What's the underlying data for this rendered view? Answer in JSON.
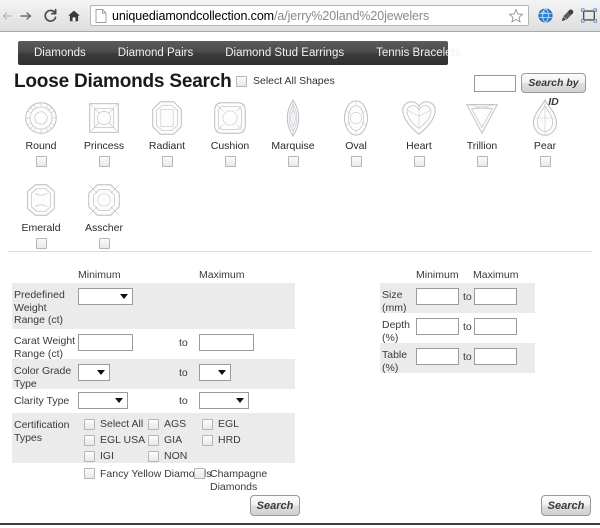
{
  "browser": {
    "back_icon": "back-arrow-icon",
    "forward_icon": "forward-arrow-icon",
    "reload_icon": "reload-icon",
    "home_icon": "home-icon",
    "page_icon": "page-document-icon",
    "url_domain": "uniquediamondcollection.com",
    "url_path": "/a/jerry%20land%20jewelers",
    "star_icon": "bookmark-star-icon",
    "globe_icon": "globe-icon",
    "eyedropper_icon": "eyedropper-icon",
    "capture_icon": "screen-capture-icon"
  },
  "site_nav": {
    "items": [
      {
        "label": "Diamonds"
      },
      {
        "label": "Diamond Pairs"
      },
      {
        "label": "Diamond Stud Earrings"
      },
      {
        "label": "Tennis Bracelets"
      }
    ]
  },
  "header": {
    "title": "Loose Diamonds Search",
    "select_all_shapes_label": "Select All Shapes",
    "search_by_id_value": "",
    "search_by_id_label": "Search by ID"
  },
  "shapes": [
    {
      "label": "Round",
      "icon": "diamond-round-icon"
    },
    {
      "label": "Princess",
      "icon": "diamond-princess-icon"
    },
    {
      "label": "Radiant",
      "icon": "diamond-radiant-icon"
    },
    {
      "label": "Cushion",
      "icon": "diamond-cushion-icon"
    },
    {
      "label": "Marquise",
      "icon": "diamond-marquise-icon"
    },
    {
      "label": "Oval",
      "icon": "diamond-oval-icon"
    },
    {
      "label": "Heart",
      "icon": "diamond-heart-icon"
    },
    {
      "label": "Trillion",
      "icon": "diamond-trillion-icon"
    },
    {
      "label": "Pear",
      "icon": "diamond-pear-icon"
    },
    {
      "label": "Emerald",
      "icon": "diamond-emerald-icon"
    },
    {
      "label": "Asscher",
      "icon": "diamond-asscher-icon"
    }
  ],
  "left_panel": {
    "col_min": "Minimum",
    "col_max": "Maximum",
    "rows": {
      "predefined_weight": {
        "label": "Predefined Weight Range (ct)",
        "min_value": ""
      },
      "carat_weight": {
        "label": "Carat Weight Range (ct)",
        "min_value": "",
        "to": "to",
        "max_value": ""
      },
      "color_grade": {
        "label": "Color Grade Type",
        "min_value": "",
        "to": "to",
        "max_value": ""
      },
      "clarity": {
        "label": "Clarity Type",
        "min_value": "",
        "to": "to",
        "max_value": ""
      },
      "certification": {
        "label": "Certification Types",
        "options": [
          {
            "label": "Select All"
          },
          {
            "label": "AGS"
          },
          {
            "label": "EGL"
          },
          {
            "label": "EGL USA"
          },
          {
            "label": "GIA"
          },
          {
            "label": "HRD"
          },
          {
            "label": "IGI"
          },
          {
            "label": "NON"
          }
        ]
      },
      "fancy": {
        "yellow_label": "Fancy Yellow Diamonds",
        "champagne_label": "Champagne Diamonds"
      }
    }
  },
  "right_panel": {
    "col_min": "Minimum",
    "col_max": "Maximum",
    "rows": [
      {
        "label": "Size (mm)",
        "min_value": "",
        "to": "to",
        "max_value": ""
      },
      {
        "label": "Depth (%)",
        "min_value": "",
        "to": "to",
        "max_value": ""
      },
      {
        "label": "Table (%)",
        "min_value": "",
        "to": "to",
        "max_value": ""
      }
    ]
  },
  "footer": {
    "search_left_label": "Search",
    "search_right_label": "Search"
  },
  "colors": {
    "nav_dark": "#3a3a3a",
    "row_gray": "#ebebeb",
    "page_white": "#ffffff",
    "text": "#3a3a3a"
  }
}
